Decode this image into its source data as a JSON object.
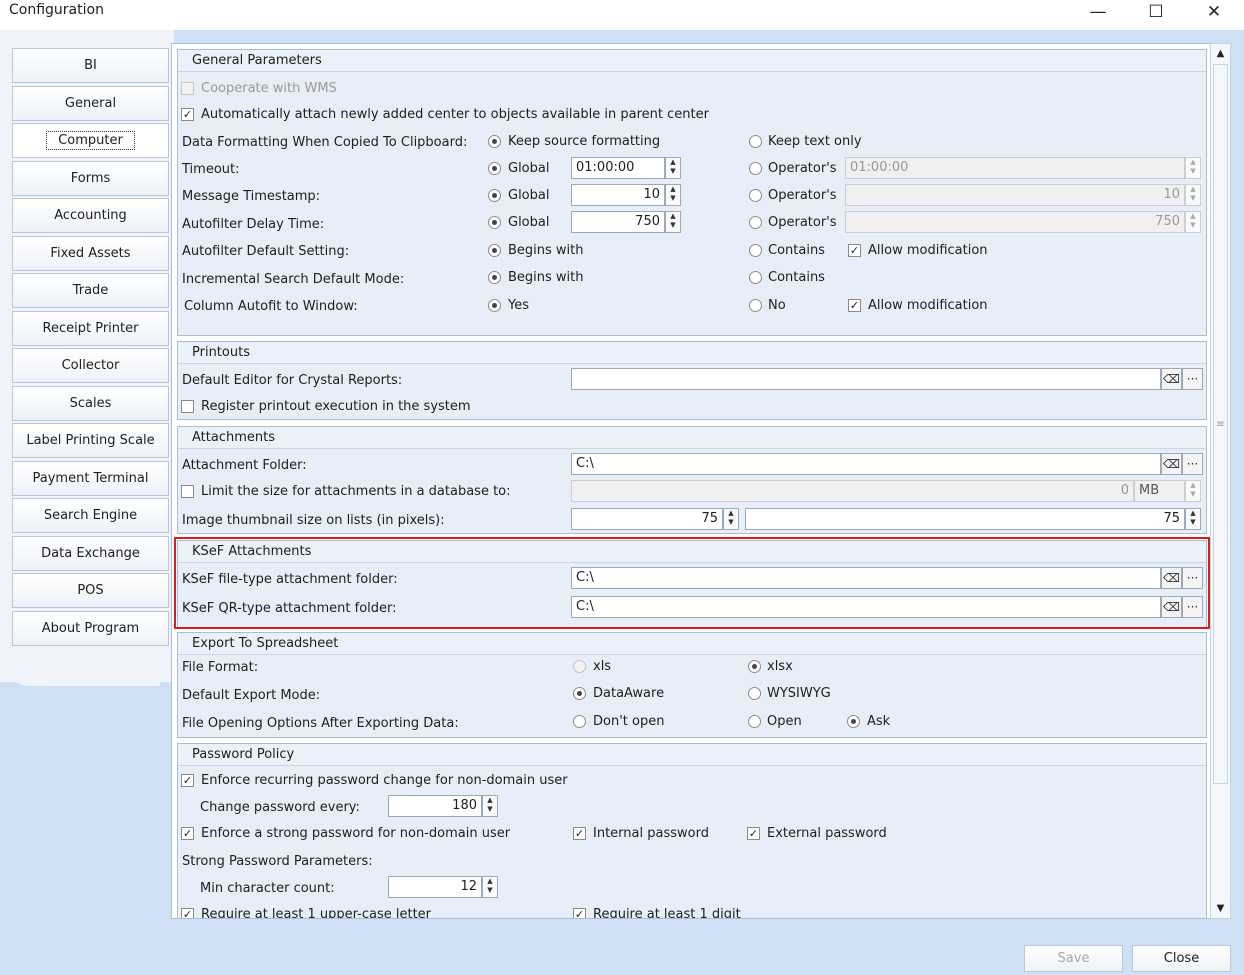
{
  "window": {
    "title": "Configuration",
    "minimize": "—",
    "maximize": "☐",
    "close": "✕"
  },
  "nav": [
    {
      "label": "BI"
    },
    {
      "label": "General"
    },
    {
      "label": "Computer"
    },
    {
      "label": "Forms"
    },
    {
      "label": "Accounting"
    },
    {
      "label": "Fixed Assets"
    },
    {
      "label": "Trade"
    },
    {
      "label": "Receipt Printer"
    },
    {
      "label": "Collector"
    },
    {
      "label": "Scales"
    },
    {
      "label": "Label Printing Scale"
    },
    {
      "label": "Payment Terminal"
    },
    {
      "label": "Search Engine"
    },
    {
      "label": "Data Exchange"
    },
    {
      "label": "POS"
    },
    {
      "label": "About Program"
    }
  ],
  "general": {
    "title": "General Parameters",
    "cooperate_wms": "Cooperate with WMS",
    "auto_attach": "Automatically attach newly added center to objects available in parent center",
    "data_formatting": {
      "label": "Data Formatting When Copied To Clipboard:",
      "opt1": "Keep source formatting",
      "opt2": "Keep text only"
    },
    "timeout": {
      "label": "Timeout:",
      "global": "Global",
      "value": "01:00:00",
      "operator": "Operator's",
      "op_value": "01:00:00"
    },
    "message_ts": {
      "label": "Message Timestamp:",
      "global": "Global",
      "value": "10",
      "operator": "Operator's",
      "op_value": "10"
    },
    "autofilter_delay": {
      "label": "Autofilter Delay Time:",
      "global": "Global",
      "value": "750",
      "operator": "Operator's",
      "op_value": "750"
    },
    "autofilter_default": {
      "label": "Autofilter Default Setting:",
      "opt1": "Begins with",
      "opt2": "Contains",
      "allow": "Allow modification"
    },
    "incremental": {
      "label": "Incremental Search Default Mode:",
      "opt1": "Begins with",
      "opt2": "Contains"
    },
    "autofit": {
      "label": "Column Autofit to Window:",
      "opt1": "Yes",
      "opt2": "No",
      "allow": "Allow modification"
    }
  },
  "printouts": {
    "title": "Printouts",
    "default_editor": "Default Editor for Crystal Reports:",
    "default_editor_value": "",
    "register": "Register printout execution in the system"
  },
  "attachments": {
    "title": "Attachments",
    "folder_label": "Attachment Folder:",
    "folder_value": "C:\\",
    "limit_label": "Limit the size for attachments in a database to:",
    "limit_value": "0",
    "limit_unit": "MB",
    "thumb_label": "Image thumbnail size on lists (in pixels):",
    "thumb_w": "75",
    "thumb_h": "75"
  },
  "ksef": {
    "title": "KSeF Attachments",
    "file_label": "KSeF file-type attachment folder:",
    "file_value": "C:\\",
    "qr_label": "KSeF QR-type attachment folder:",
    "qr_value": "C:\\"
  },
  "export": {
    "title": "Export To Spreadsheet",
    "format_label": "File Format:",
    "xls": "xls",
    "xlsx": "xlsx",
    "mode_label": "Default Export Mode:",
    "dataaware": "DataAware",
    "wysiwyg": "WYSIWYG",
    "open_label": "File Opening Options After Exporting Data:",
    "dont_open": "Don't open",
    "open": "Open",
    "ask": "Ask"
  },
  "password": {
    "title": "Password Policy",
    "enforce_recurring": "Enforce recurring password change for non-domain user",
    "change_every": "Change password every:",
    "change_value": "180",
    "enforce_strong": "Enforce a strong password for non-domain user",
    "internal": "Internal password",
    "external": "External password",
    "strong_params": "Strong Password Parameters:",
    "min_chars": "Min character count:",
    "min_value": "12",
    "upper": "Require at least 1 upper-case letter",
    "digit": "Require at least 1 digit"
  },
  "footer": {
    "save": "Save",
    "close": "Close"
  },
  "colors": {
    "highlight": "#d71e1e",
    "frame": "#cfe0f4"
  }
}
